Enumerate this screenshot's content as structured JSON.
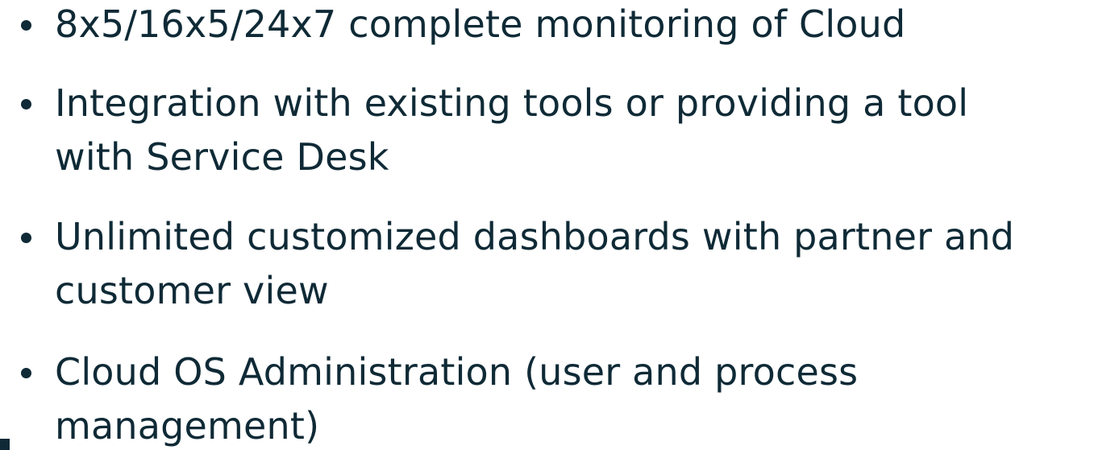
{
  "bullets": [
    {
      "text": "8x5/16x5/24x7 complete monitoring of Cloud"
    },
    {
      "text": "Integration with existing tools or providing a tool\nwith Service Desk"
    },
    {
      "text": "Unlimited customized dashboards with partner and\ncustomer view"
    },
    {
      "text": "Cloud OS Administration (user and process\nmanagement)"
    }
  ],
  "colors": {
    "text": "#0f2a36",
    "background": "#ffffff"
  }
}
